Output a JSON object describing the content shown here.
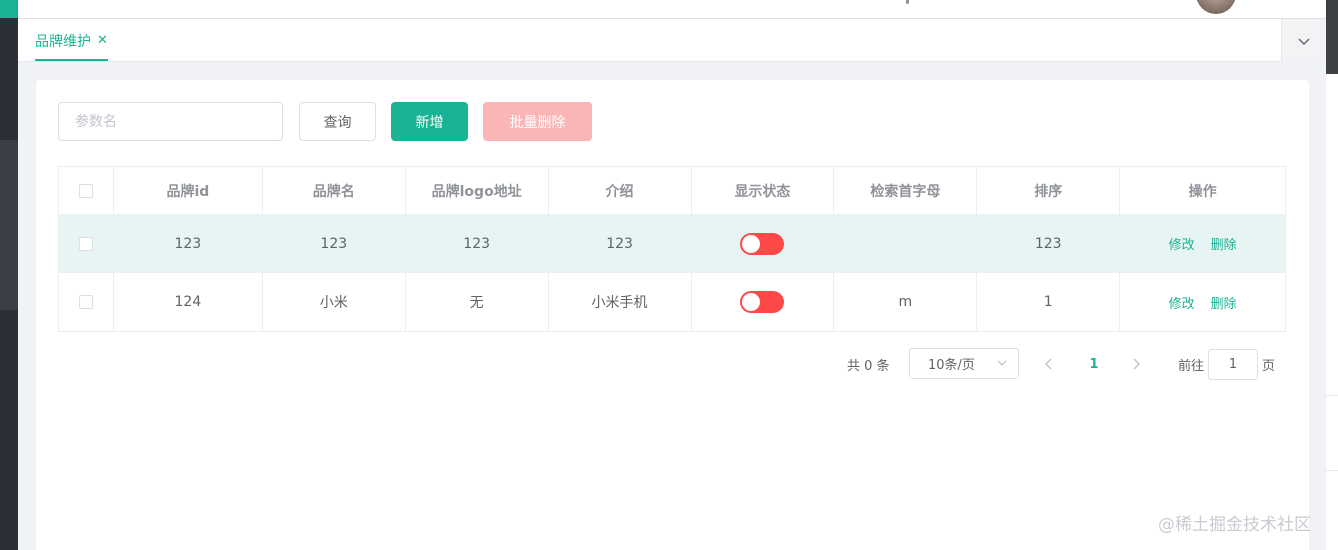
{
  "tab": {
    "label": "品牌维护",
    "close_glyph": "✕"
  },
  "search": {
    "placeholder": "参数名"
  },
  "toolbar": {
    "query_label": "查询",
    "add_label": "新增",
    "batch_delete_label": "批量删除"
  },
  "table": {
    "columns": [
      "品牌id",
      "品牌名",
      "品牌logo地址",
      "介绍",
      "显示状态",
      "检索首字母",
      "排序",
      "操作"
    ],
    "rows": [
      {
        "id": "123",
        "name": "123",
        "logo": "123",
        "desc": "123",
        "show_status": false,
        "first_letter": "",
        "sort": "123",
        "edit": "修改",
        "delete": "删除"
      },
      {
        "id": "124",
        "name": "小米",
        "logo": "无",
        "desc": "小米手机",
        "show_status": false,
        "first_letter": "m",
        "sort": "1",
        "edit": "修改",
        "delete": "删除"
      }
    ]
  },
  "pagination": {
    "total_text": "共 0 条",
    "page_size": "10条/页",
    "current_page": "1",
    "goto_prefix": "前往",
    "goto_value": "1",
    "goto_suffix": "页"
  },
  "watermark": "@稀土掘金技术社区",
  "colors": {
    "accent": "#1ab394",
    "danger_light": "#fab6b6",
    "switch_off": "#ff4949",
    "row_highlight": "#e6f4f3"
  }
}
